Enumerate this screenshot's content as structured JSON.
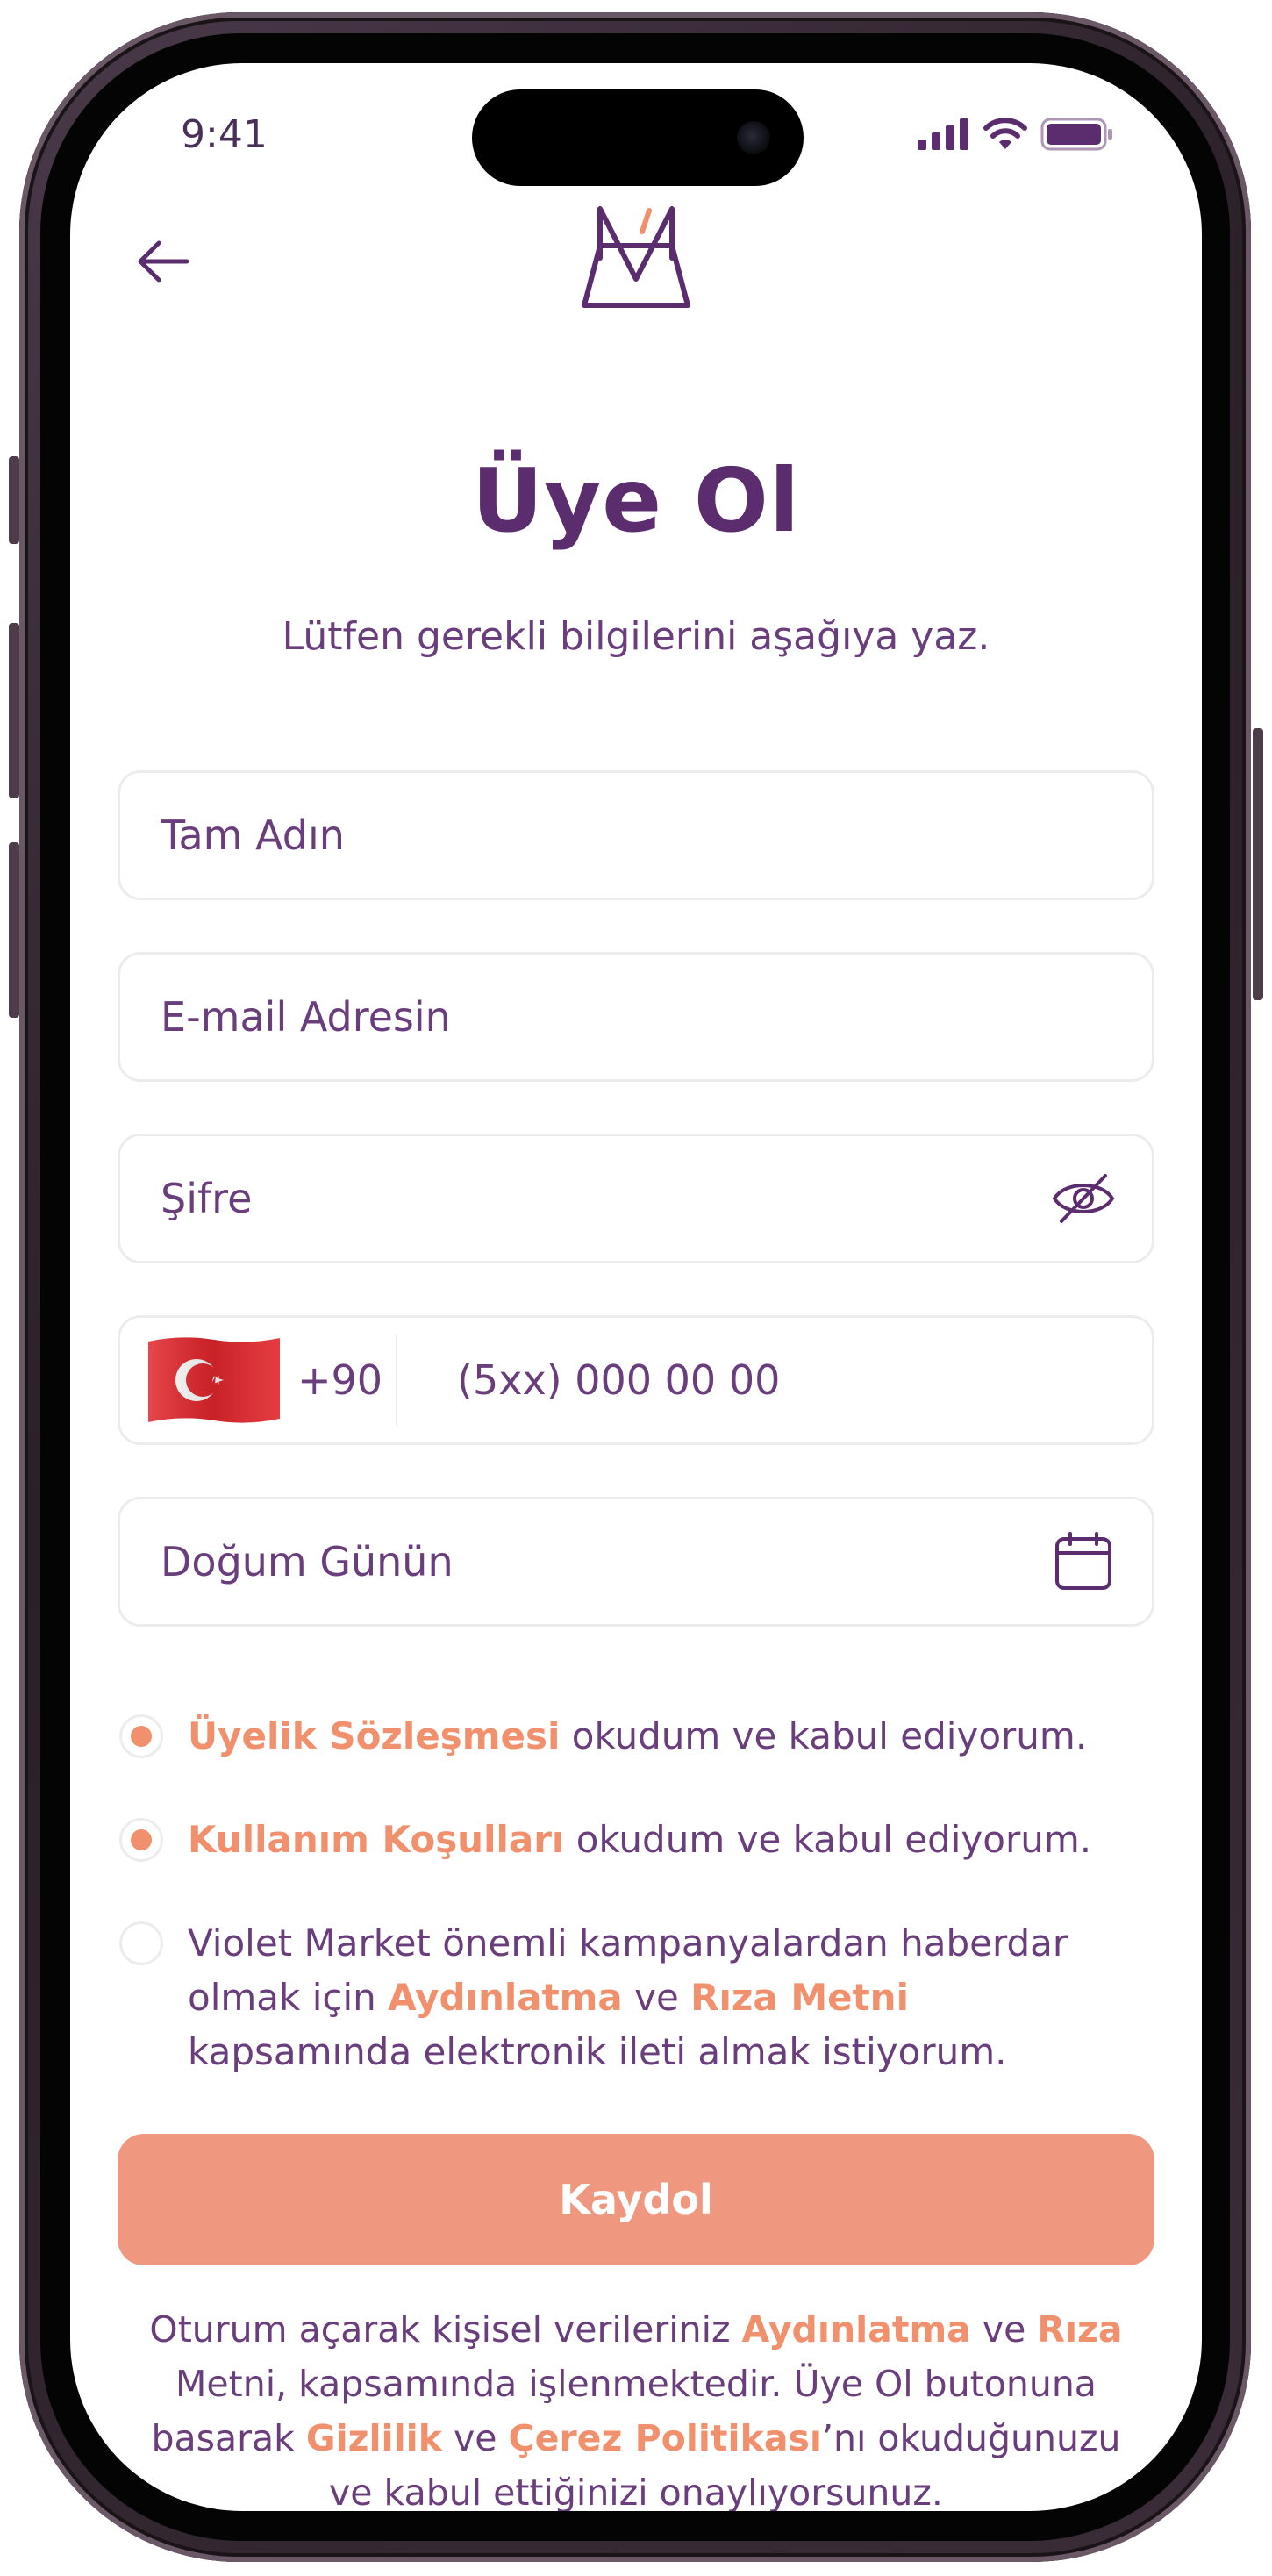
{
  "status_bar": {
    "time": "9:41"
  },
  "header": {
    "back_icon": "arrow-left-icon",
    "logo_icon": "violet-bag-logo"
  },
  "page": {
    "title": "Üye Ol",
    "subtitle": "Lütfen gerekli bilgilerini aşağıya yaz."
  },
  "form": {
    "full_name": {
      "value": "",
      "placeholder": "Tam Adın"
    },
    "email": {
      "value": "",
      "placeholder": "E-mail Adresin"
    },
    "password": {
      "value": "",
      "placeholder": "Şifre",
      "toggle_icon": "eye-off-icon"
    },
    "phone": {
      "country_flag": "turkey-flag-icon",
      "country_code": "+90",
      "value": "",
      "placeholder": "(5xx) 000 00 00"
    },
    "birthday": {
      "value": "",
      "placeholder": "Doğum Günün",
      "icon": "calendar-icon"
    }
  },
  "consents": [
    {
      "checked": true,
      "link": "Üyelik Sözleşmesi",
      "text": " okudum ve kabul ediyorum."
    },
    {
      "checked": true,
      "link": "Kullanım Koşulları",
      "text": " okudum ve kabul ediyorum."
    },
    {
      "checked": false,
      "text_1": "Violet Market önemli kampanyalardan haberdar olmak için ",
      "link_1": "Aydınlatma",
      "text_2": " ve ",
      "link_2": "Rıza Metni",
      "text_3": " kapsamında elektronik ileti almak istiyorum."
    }
  ],
  "submit": {
    "label": "Kaydol"
  },
  "footer": {
    "text_1": "Oturum açarak kişisel verileriniz ",
    "link_1": "Aydınlatma",
    "text_2": " ve ",
    "link_2": "Rıza",
    "text_3": " Metni, kapsamında işlenmektedir. Üye Ol butonuna basarak ",
    "link_3": "Gizlilik",
    "text_4": " ve ",
    "link_4": "Çerez Politikası",
    "text_5": "’nı okuduğunuzu ve kabul ettiğinizi onaylıyorsunuz."
  },
  "colors": {
    "primary": "#5b2d6e",
    "text": "#6a3d7c",
    "accent": "#f0906c",
    "button": "#f0987f",
    "border": "#ececec"
  }
}
